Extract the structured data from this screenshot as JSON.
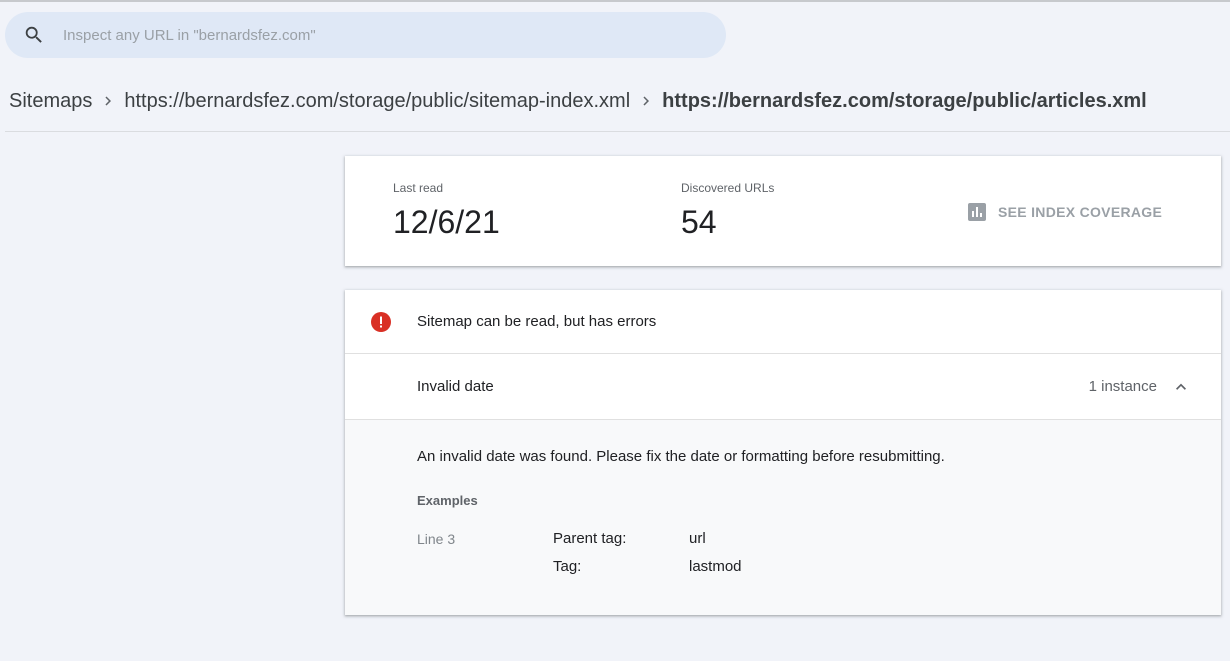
{
  "search": {
    "placeholder": "Inspect any URL in \"bernardsfez.com\"",
    "value": ""
  },
  "breadcrumb": {
    "items": [
      "Sitemaps",
      "https://bernardsfez.com/storage/public/sitemap-index.xml",
      "https://bernardsfez.com/storage/public/articles.xml"
    ]
  },
  "stats": {
    "last_read_label": "Last read",
    "last_read_value": "12/6/21",
    "discovered_label": "Discovered URLs",
    "discovered_value": "54",
    "coverage_button": "SEE INDEX COVERAGE"
  },
  "status": {
    "message": "Sitemap can be read, but has errors",
    "color": "#d93025"
  },
  "issue": {
    "title": "Invalid date",
    "count": "1 instance",
    "description": "An invalid date was found. Please fix the date or formatting before resubmitting.",
    "examples_label": "Examples",
    "example": {
      "line": "Line 3",
      "parent_tag_label": "Parent tag:",
      "parent_tag_value": "url",
      "tag_label": "Tag:",
      "tag_value": "lastmod"
    }
  },
  "icons": {
    "search": "search-icon",
    "chevron": "chevron-right-icon",
    "chart": "bar-chart-icon",
    "error": "error-icon",
    "collapse": "chevron-up-icon"
  }
}
